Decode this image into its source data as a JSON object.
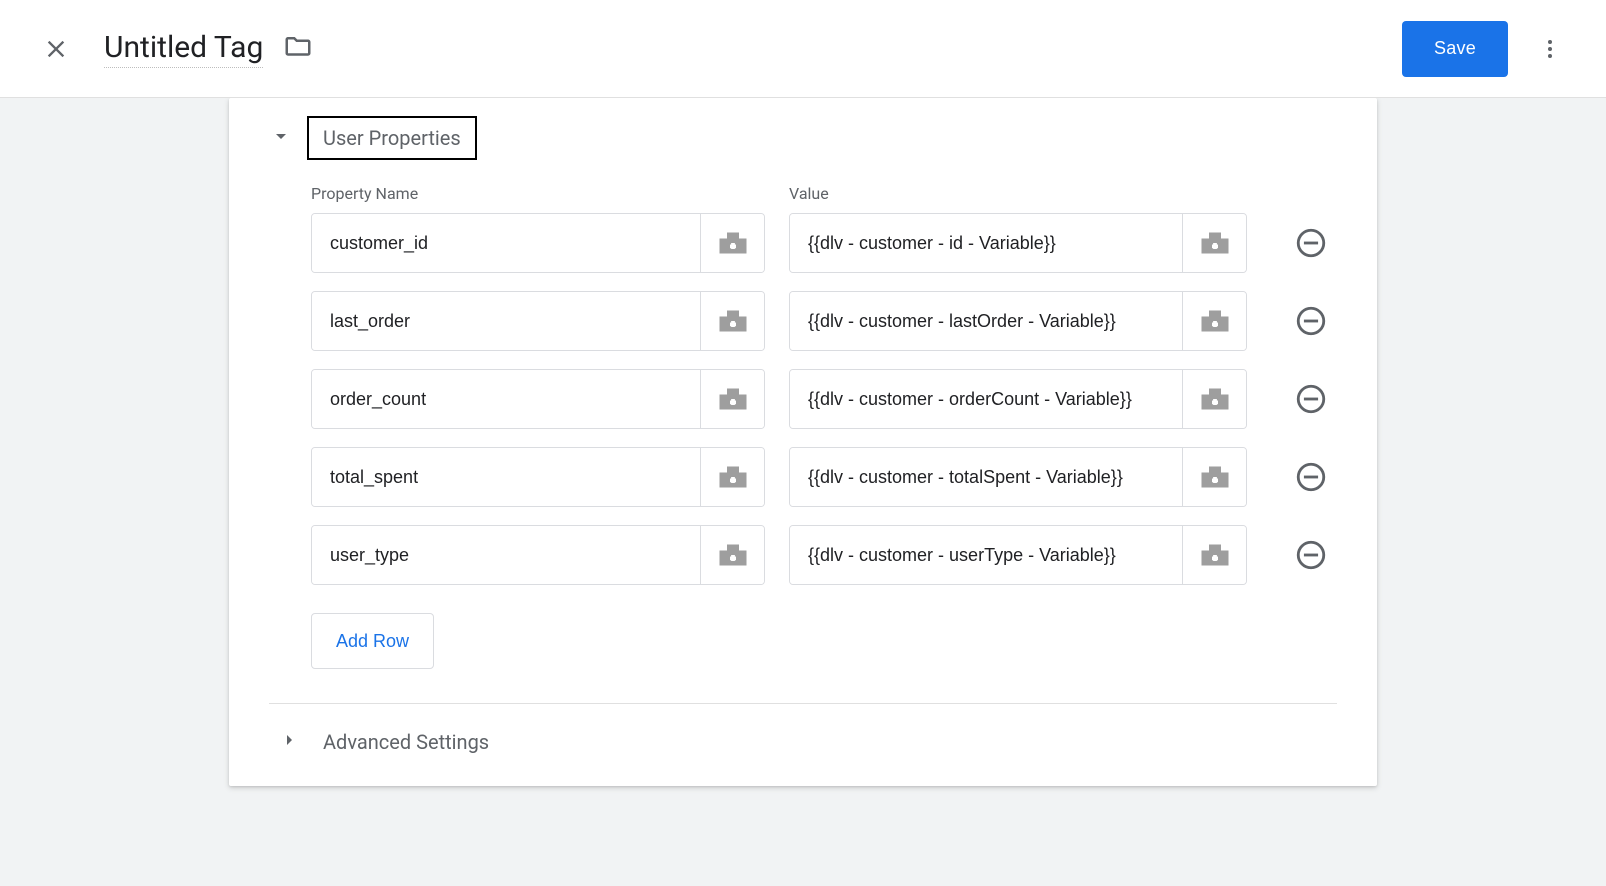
{
  "header": {
    "title": "Untitled Tag",
    "save_label": "Save"
  },
  "user_properties": {
    "section_title": "User Properties",
    "col_property_name": "Property Name",
    "col_value": "Value",
    "rows": [
      {
        "name": "customer_id",
        "value": "{{dlv - customer - id - Variable}}"
      },
      {
        "name": "last_order",
        "value": "{{dlv - customer - lastOrder - Variable}}"
      },
      {
        "name": "order_count",
        "value": "{{dlv - customer - orderCount - Variable}}"
      },
      {
        "name": "total_spent",
        "value": "{{dlv - customer - totalSpent - Variable}}"
      },
      {
        "name": "user_type",
        "value": "{{dlv - customer - userType - Variable}}"
      }
    ],
    "add_row_label": "Add Row"
  },
  "advanced_settings": {
    "label": "Advanced Settings"
  }
}
